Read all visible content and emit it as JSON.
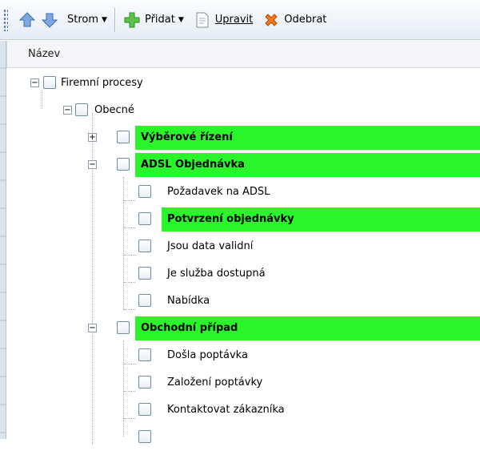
{
  "toolbar": {
    "tree_label": "Strom",
    "add_label": "Přidat",
    "edit_label": "Upravit",
    "remove_label": "Odebrat"
  },
  "tree": {
    "column_header": "Název",
    "root": {
      "label": "Firemní procesy"
    },
    "general": {
      "label": "Obecné"
    },
    "selection": {
      "label": "Výběrové řízení"
    },
    "adsl": {
      "label": "ADSL Objednávka",
      "children": [
        "Požadavek na ADSL",
        "Potvrzení objednávky",
        "Jsou data validní",
        "Je služba dostupná",
        "Nabídka"
      ]
    },
    "business": {
      "label": "Obchodní případ",
      "children": [
        "Došla poptávka",
        "Založení poptávky",
        "Kontaktovat zákazníka"
      ]
    }
  },
  "colors": {
    "highlight": "#2af52a"
  }
}
